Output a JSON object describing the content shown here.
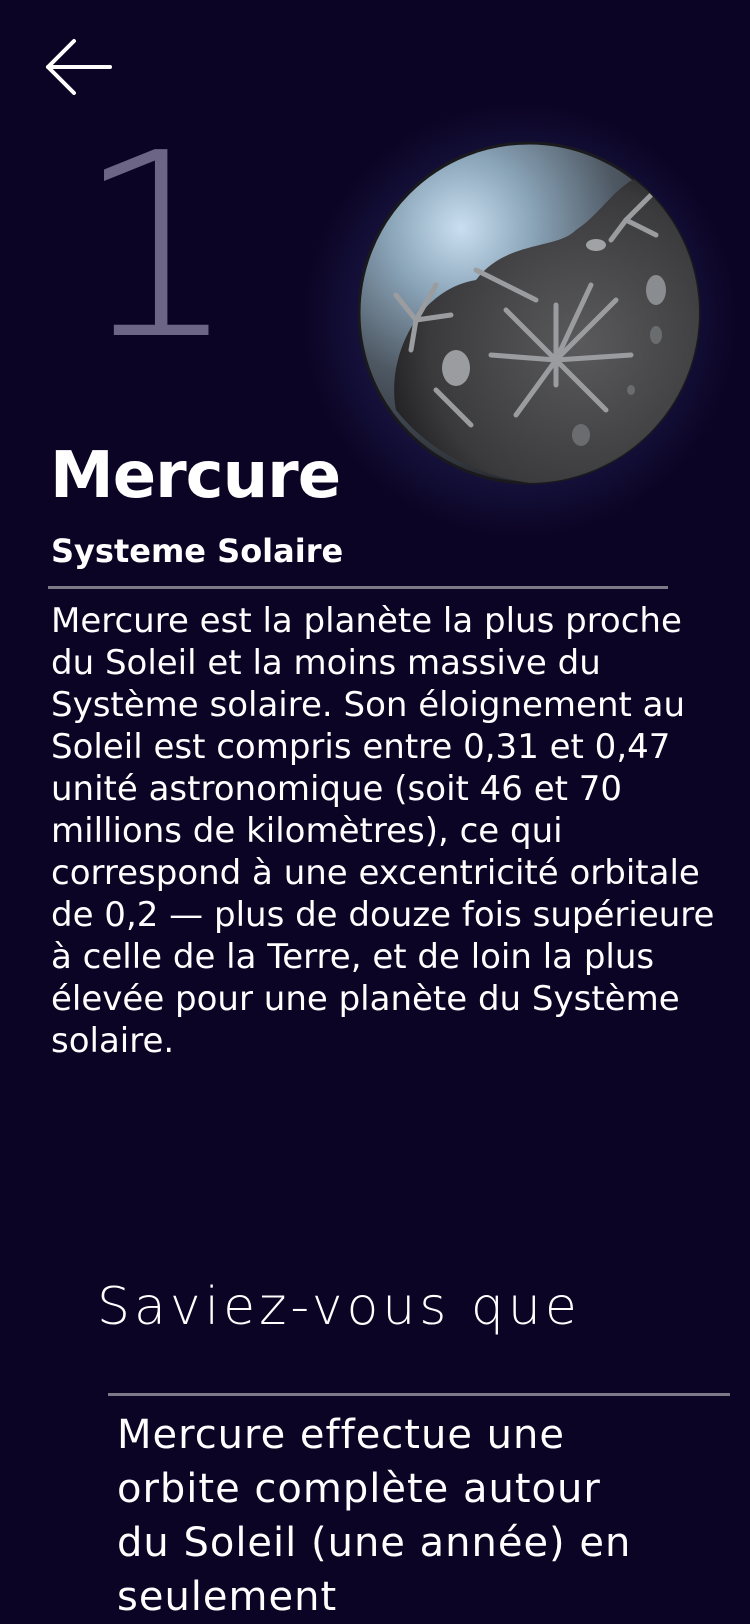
{
  "nav": {
    "back_icon": "arrow-left-icon"
  },
  "planet": {
    "index": "1",
    "name": "Mercure",
    "category": "Systeme Solaire",
    "image_icon": "mercury-planet-icon",
    "description": "Mercure est la planète la plus proche du Soleil et la moins massive du Système solaire. Son éloignement au Soleil est compris entre 0,31 et 0,47 unité astronomique (soit 46 et 70 millions de kilomètres), ce qui correspond à une excentricité orbitale de 0,2 — plus de douze fois supérieure à celle de la Terre, et de loin la plus élevée pour une planète du Système solaire."
  },
  "fact": {
    "heading": "Saviez-vous que",
    "text": "Mercure effectue une orbite complète autour du Soleil (une année) en seulement"
  },
  "colors": {
    "background": "#0c0424",
    "number": "#6c6585",
    "divider": "#7c7a86",
    "text": "#ffffff"
  }
}
